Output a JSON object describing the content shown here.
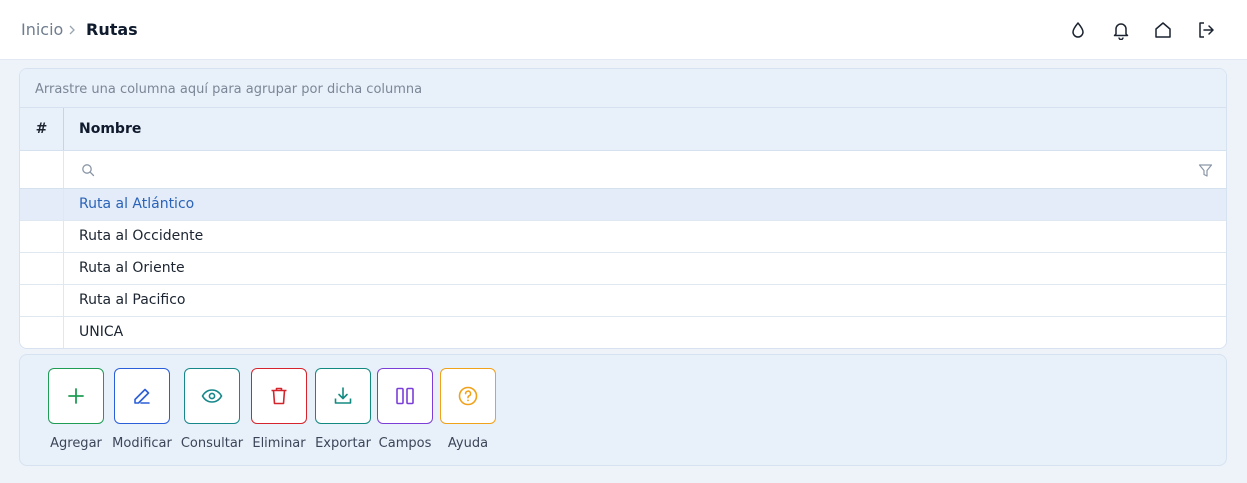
{
  "breadcrumb": {
    "home": "Inicio",
    "current": "Rutas"
  },
  "top_icons": [
    "drop-icon",
    "bell-icon",
    "home-icon",
    "logout-icon"
  ],
  "grid": {
    "group_hint": "Arrastre una columna aquí para agrupar por dicha columna",
    "columns": {
      "index": "#",
      "name": "Nombre"
    },
    "search": {
      "value": "",
      "placeholder": ""
    },
    "rows": [
      {
        "name": "Ruta al Atlántico",
        "selected": true
      },
      {
        "name": "Ruta al Occidente",
        "selected": false
      },
      {
        "name": "Ruta al Oriente",
        "selected": false
      },
      {
        "name": "Ruta al Pacifico",
        "selected": false
      },
      {
        "name": "UNICA",
        "selected": false
      }
    ]
  },
  "toolbar": {
    "buttons": [
      {
        "label": "Agregar",
        "icon": "plus-icon",
        "color": "#1f9d55"
      },
      {
        "label": "Modificar",
        "icon": "pencil-icon",
        "color": "#2b5fd9"
      },
      {
        "label": "Consultar",
        "icon": "eye-icon",
        "color": "#16888a"
      },
      {
        "label": "Eliminar",
        "icon": "trash-icon",
        "color": "#d6242c"
      },
      {
        "label": "Exportar",
        "icon": "download-icon",
        "color": "#138a80"
      },
      {
        "label": "Campos",
        "icon": "columns-icon",
        "color": "#7b3fd8"
      },
      {
        "label": "Ayuda",
        "icon": "help-icon",
        "color": "#f0a21a"
      }
    ]
  },
  "colors": {
    "background": "#eef3fa",
    "selected_row": "#e3ecf8",
    "selected_text": "#2a63b8"
  }
}
